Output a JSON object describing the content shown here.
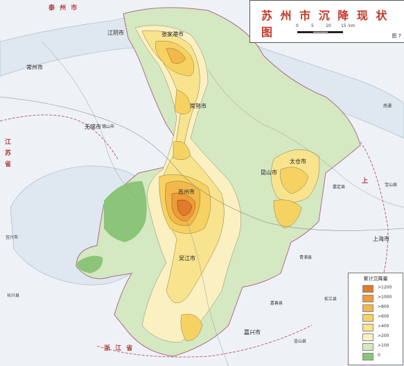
{
  "title": "苏 州 市 沉 降 现 状 图",
  "scale": {
    "unit": "km",
    "ticks": [
      "0",
      "5",
      "10",
      "15"
    ]
  },
  "figure_no": "图 7",
  "legend": {
    "title": "累计沉降量",
    "items": [
      {
        "label": ">1200",
        "color": "#e07b2a"
      },
      {
        "label": ">1000",
        "color": "#ec9c38"
      },
      {
        "label": ">800",
        "color": "#f2b84b"
      },
      {
        "label": ">600",
        "color": "#f6d262"
      },
      {
        "label": ">400",
        "color": "#f8e38e"
      },
      {
        "label": ">200",
        "color": "#faf0c2"
      },
      {
        "label": ">100",
        "color": "#d4e8c2"
      },
      {
        "label": "0",
        "color": "#8cc47a"
      }
    ]
  },
  "places": {
    "taizhou": "泰 州 市",
    "wuxi_city": "无锡市",
    "changzhou_city": "常州市",
    "jiangyin": "江阴市",
    "zhangjiagang": "张家港市",
    "changshu": "常熟市",
    "taicang": "太仓市",
    "kunshan": "昆山市",
    "suzhou": "苏州市",
    "wujiang": "吴江市",
    "shanghai": "上海市",
    "jiaxing": "嘉兴市",
    "xishan": "锡山市",
    "yixing": "宜兴市",
    "changxing": "长兴县",
    "jiashan": "嘉善县",
    "qingpu": "青浦县",
    "songjiang": "松江县",
    "jinshan": "金山县",
    "jiading": "嘉定县",
    "baoshan": "宝山县",
    "nantong": "南通",
    "zhejiang": "浙 江 省",
    "shanghai_side": "上",
    "jiangsu": "江 苏 省"
  }
}
